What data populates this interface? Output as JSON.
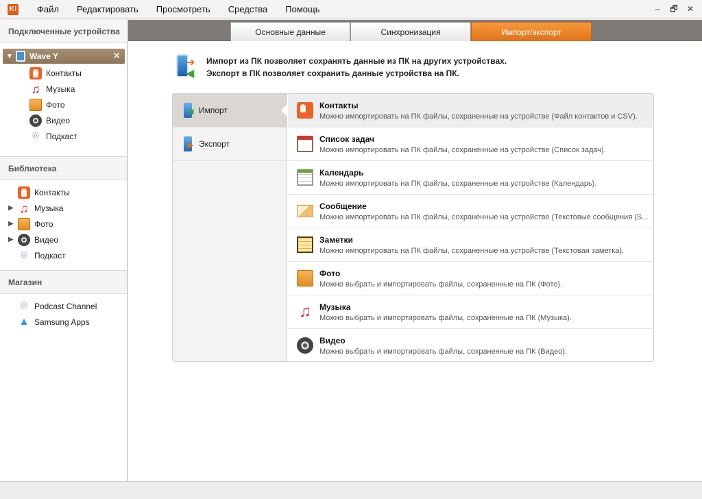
{
  "app": {
    "logo_text": "K!"
  },
  "menu": [
    "Файл",
    "Редактировать",
    "Просмотреть",
    "Средства",
    "Помощь"
  ],
  "window_controls": [
    "–",
    "🗗",
    "✕"
  ],
  "sidebar": {
    "connected_header": "Подключенные устройства",
    "device": {
      "name": "Wave Y",
      "close": "✕"
    },
    "device_items": [
      {
        "label": "Контакты",
        "icon": "contacts-icon"
      },
      {
        "label": "Музыка",
        "icon": "music-icon"
      },
      {
        "label": "Фото",
        "icon": "photo-icon"
      },
      {
        "label": "Видео",
        "icon": "video-icon"
      },
      {
        "label": "Подкаст",
        "icon": "podcast-icon"
      }
    ],
    "library_header": "Библиотека",
    "library_items": [
      {
        "label": "Контакты",
        "icon": "contacts-icon"
      },
      {
        "label": "Музыка",
        "icon": "music-icon"
      },
      {
        "label": "Фото",
        "icon": "photo-icon"
      },
      {
        "label": "Видео",
        "icon": "video-icon"
      },
      {
        "label": "Подкаст",
        "icon": "podcast-icon"
      }
    ],
    "store_header": "Магазин",
    "store_items": [
      {
        "label": "Podcast Channel",
        "icon": "podcast-icon"
      },
      {
        "label": "Samsung Apps",
        "icon": "samsung-apps-icon"
      }
    ]
  },
  "tabs": [
    {
      "label": "Основные данные",
      "active": false
    },
    {
      "label": "Синхронизация",
      "active": false
    },
    {
      "label": "Импорт/экспорт",
      "active": true
    }
  ],
  "intro": {
    "line1": "Импорт из ПК позволяет сохранять данные из ПК на других устройствах.",
    "line2": "Экспорт в ПК позволяет сохранить данные устройства на ПК."
  },
  "side_tabs": [
    {
      "label": "Импорт",
      "active": true
    },
    {
      "label": "Экспорт",
      "active": false
    }
  ],
  "rows": [
    {
      "title": "Контакты",
      "desc": "Можно импортировать на ПК файлы, сохраненные на устройстве (Файл контактов и CSV).",
      "icon": "contacts-icon"
    },
    {
      "title": "Список задач",
      "desc": "Можно импортировать на ПК файлы, сохраненные на устройстве (Список задач).",
      "icon": "tasks-icon"
    },
    {
      "title": "Календарь",
      "desc": "Можно импортировать на ПК файлы, сохраненные на устройстве (Календарь).",
      "icon": "calendar-icon"
    },
    {
      "title": "Сообщение",
      "desc": "Можно импортировать на ПК файлы, сохраненные на устройстве (Текстовые сообщения (S...",
      "icon": "message-icon"
    },
    {
      "title": "Заметки",
      "desc": "Можно импортировать на ПК файлы, сохраненные на устройстве (Текстовая заметка).",
      "icon": "notes-icon"
    },
    {
      "title": "Фото",
      "desc": "Можно выбрать и импортировать файлы, сохраненные на ПК (Фото).",
      "icon": "photo-icon"
    },
    {
      "title": "Музыка",
      "desc": "Можно выбрать и импортировать файлы, сохраненные на ПК (Музыка).",
      "icon": "music-icon"
    },
    {
      "title": "Видео",
      "desc": "Можно выбрать и импортировать файлы, сохраненные на ПК (Видео).",
      "icon": "video-icon"
    }
  ]
}
